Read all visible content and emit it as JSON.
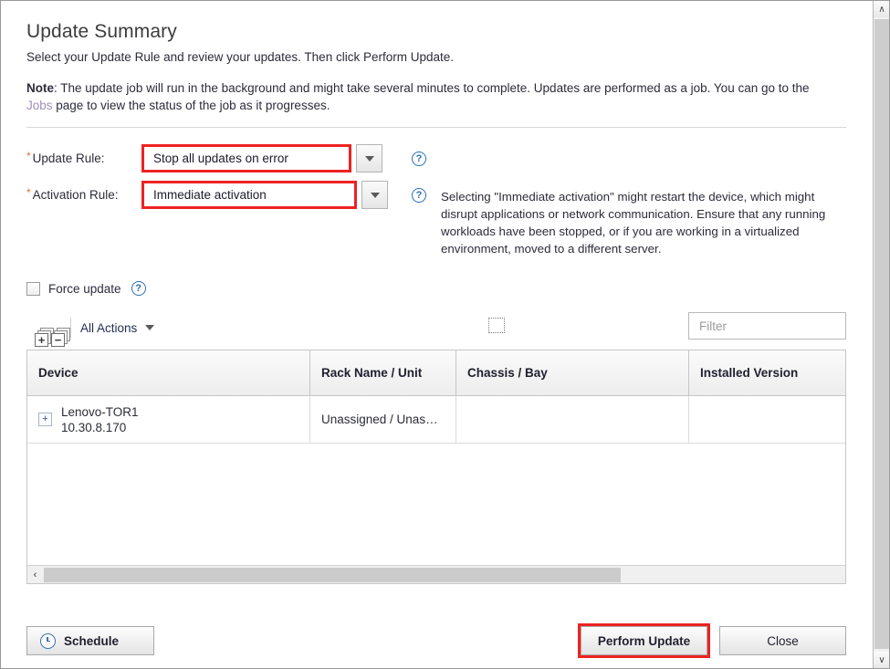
{
  "page": {
    "title": "Update Summary",
    "subtitle": "Select your Update Rule and review your updates. Then click Perform Update.",
    "note_label": "Note",
    "note_text_1": ": The update job will run in the background and might take several minutes to complete. Updates are performed as a job. You can go to the ",
    "note_link": "Jobs",
    "note_text_2": " page to view the status of the job as it progresses."
  },
  "form": {
    "required_mark": "*",
    "update_rule": {
      "label": "Update Rule:",
      "value": "Stop all updates on error",
      "help_glyph": "?"
    },
    "activation_rule": {
      "label": "Activation Rule:",
      "value": "Immediate activation",
      "help_glyph": "?",
      "description": "Selecting \"Immediate activation\" might restart the device, which might disrupt applications or network communication. Ensure that any running workloads have been stopped, or if you are working in a virtualized environment, moved to a different server."
    },
    "force_update": {
      "label": "Force update",
      "checked": false,
      "help_glyph": "?"
    }
  },
  "toolbar": {
    "add_label": "+",
    "remove_label": "−",
    "all_actions_label": "All Actions",
    "filter_placeholder": "Filter",
    "filter_value": ""
  },
  "table": {
    "columns": [
      "Device",
      "Rack Name / Unit",
      "Chassis / Bay",
      "Installed Version"
    ],
    "rows": [
      {
        "expander": "+",
        "device_name": "Lenovo-TOR1",
        "device_ip": "10.30.8.170",
        "rack_name_unit": "Unassigned / Unas…",
        "chassis_bay": "",
        "installed_version": ""
      }
    ],
    "hscroll_left_glyph": "‹"
  },
  "footer": {
    "schedule_label": "Schedule",
    "perform_update_label": "Perform Update",
    "close_label": "Close"
  },
  "scrollbar": {
    "up_glyph": "∧",
    "down_glyph": "∨"
  },
  "colors": {
    "highlight": "#ee2222",
    "link": "#9f8fb5",
    "required": "#e8703a",
    "help_blue": "#2b6fb5"
  }
}
